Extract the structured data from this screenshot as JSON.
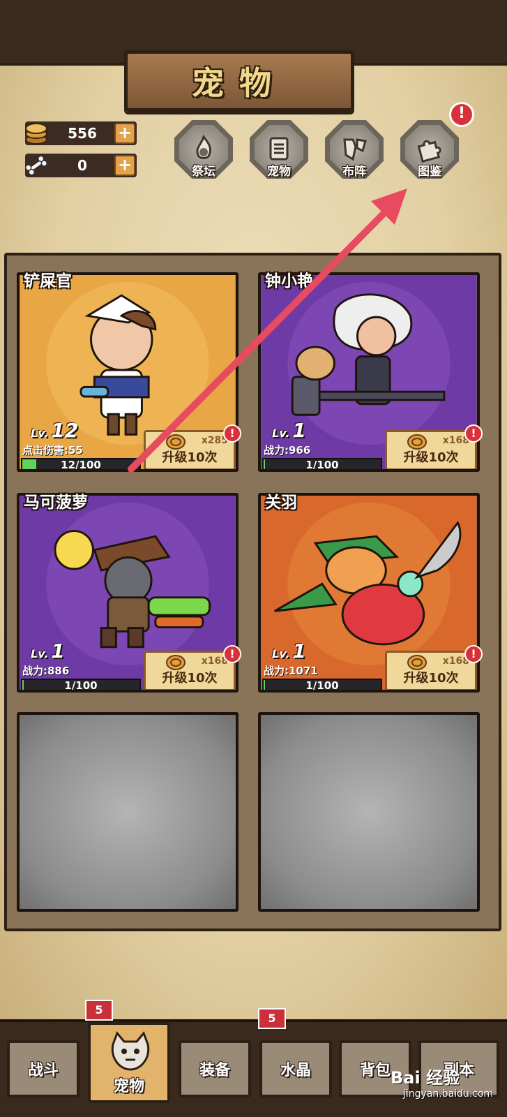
{
  "page": {
    "title": "宠物"
  },
  "currency": [
    {
      "icon": "coin-stack-icon",
      "value": "556",
      "plus": "+"
    },
    {
      "icon": "bone-icon",
      "value": "0",
      "plus": "+"
    }
  ],
  "nav": [
    {
      "label": "祭坛",
      "icon": "altar-flame-icon"
    },
    {
      "label": "宠物",
      "icon": "pet-list-icon"
    },
    {
      "label": "布阵",
      "icon": "formation-icon"
    },
    {
      "label": "图鉴",
      "icon": "puzzle-icon",
      "alert": "!"
    }
  ],
  "pets": [
    {
      "name": "铲屎官",
      "lv_prefix": "Lv.",
      "level": "12",
      "stat": "点击伤害:55",
      "progress": "12/100",
      "progress_fraction": 0.12,
      "cost": "x285",
      "upgrade": "升级10次",
      "alert": "!",
      "bg": "#e9a645"
    },
    {
      "name": "钟小艳",
      "lv_prefix": "Lv.",
      "level": "1",
      "stat": "战力:966",
      "progress": "1/100",
      "progress_fraction": 0.01,
      "cost": "x168",
      "upgrade": "升级10次",
      "alert": "!",
      "bg": "#6e3aa6"
    },
    {
      "name": "马可菠萝",
      "lv_prefix": "Lv.",
      "level": "1",
      "stat": "战力:886",
      "progress": "1/100",
      "progress_fraction": 0.01,
      "cost": "x168",
      "upgrade": "升级10次",
      "alert": "!",
      "bg": "#6e3aa6"
    },
    {
      "name": "关羽",
      "lv_prefix": "Lv.",
      "level": "1",
      "stat": "战力:1071",
      "progress": "1/100",
      "progress_fraction": 0.01,
      "cost": "x168",
      "upgrade": "升级10次",
      "alert": "!",
      "bg": "#d9682c"
    }
  ],
  "tabs": [
    {
      "label": "战斗"
    },
    {
      "label": "宠物",
      "badge": "5",
      "active": true
    },
    {
      "label": "装备"
    },
    {
      "label": "水晶",
      "badge": "5"
    },
    {
      "label": "背包"
    },
    {
      "label": "副本"
    }
  ],
  "watermark": {
    "brand": "Bai 经验",
    "url": "jingyan.baidu.com"
  },
  "colors": {
    "accent": "#e3a34b",
    "alert": "#d9303a",
    "progress": "#5fd35a",
    "arrow": "#e84a5f"
  }
}
